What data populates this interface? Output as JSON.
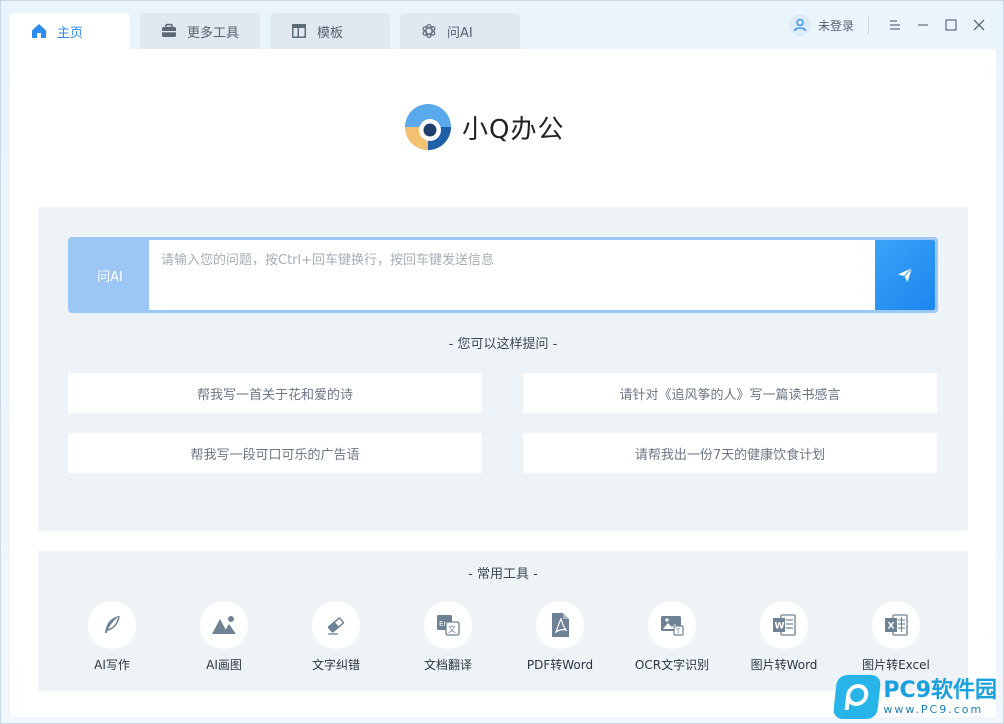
{
  "tabs": [
    {
      "label": "主页",
      "icon": "home-icon"
    },
    {
      "label": "更多工具",
      "icon": "toolbox-icon"
    },
    {
      "label": "模板",
      "icon": "template-icon"
    },
    {
      "label": "问AI",
      "icon": "ai-icon"
    }
  ],
  "user": {
    "label": "未登录"
  },
  "app": {
    "name": "小Q办公"
  },
  "ask": {
    "label": "问AI",
    "placeholder": "请输入您的问题，按Ctrl+回车键换行，按回车键发送信息",
    "value": ""
  },
  "suggestions": {
    "title": "- 您可以这样提问 -",
    "items": [
      "帮我写一首关于花和爱的诗",
      "请针对《追风筝的人》写一篇读书感言",
      "帮我写一段可口可乐的广告语",
      "请帮我出一份7天的健康饮食计划"
    ]
  },
  "tools": {
    "title": "- 常用工具 -",
    "items": [
      {
        "label": "AI写作",
        "icon": "feather-icon"
      },
      {
        "label": "AI画图",
        "icon": "painting-icon"
      },
      {
        "label": "文字纠错",
        "icon": "eraser-icon"
      },
      {
        "label": "文档翻译",
        "icon": "translate-icon"
      },
      {
        "label": "PDF转Word",
        "icon": "pdf-icon"
      },
      {
        "label": "OCR文字识别",
        "icon": "ocr-icon"
      },
      {
        "label": "图片转Word",
        "icon": "word-icon"
      },
      {
        "label": "图片转Excel",
        "icon": "excel-icon"
      }
    ]
  },
  "watermark": {
    "main": "PC9软件园",
    "sub": "www.PC9.com"
  },
  "colors": {
    "accent": "#2d8cf0",
    "send": "#1c86ee",
    "askBorder": "#9cc7f5",
    "panel": "#eef3f8",
    "icon": "#6e8296"
  }
}
